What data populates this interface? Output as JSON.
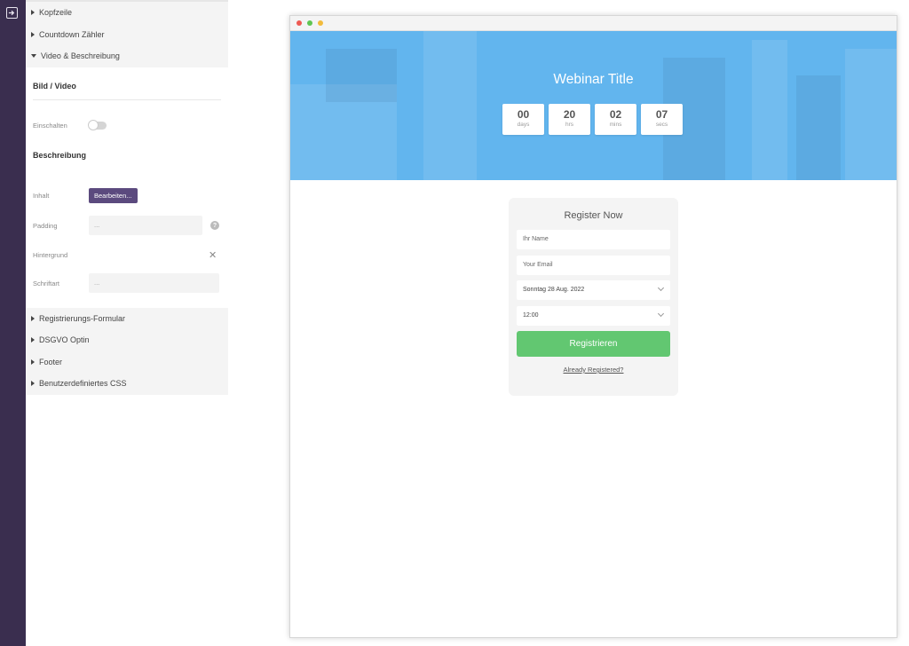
{
  "sidebar": {
    "sections_top": [
      {
        "label": "Kopfzeile"
      },
      {
        "label": "Countdown Zähler"
      },
      {
        "label": "Video & Beschreibung"
      }
    ],
    "bild_video": {
      "title": "Bild / Video",
      "einschalten_label": "Einschalten"
    },
    "beschreibung": {
      "title": "Beschreibung",
      "inhalt_label": "Inhalt",
      "edit_button": "Bearbeiten...",
      "padding_label": "Padding",
      "padding_value": "...",
      "hintergrund_label": "Hintergrund",
      "schriftart_label": "Schriftart",
      "schriftart_value": "..."
    },
    "sections_bottom": [
      {
        "label": "Registrierungs-Formular"
      },
      {
        "label": "DSGVO Optin"
      },
      {
        "label": "Footer"
      },
      {
        "label": "Benutzerdefiniertes CSS"
      }
    ]
  },
  "preview": {
    "hero_title": "Webinar Title",
    "countdown": [
      {
        "value": "00",
        "unit": "days"
      },
      {
        "value": "20",
        "unit": "hrs"
      },
      {
        "value": "02",
        "unit": "mins"
      },
      {
        "value": "07",
        "unit": "secs"
      }
    ],
    "form": {
      "title": "Register Now",
      "name_placeholder": "Ihr Name",
      "email_placeholder": "Your Email",
      "date_value": "Sonntag 28 Aug. 2022",
      "time_value": "12:00",
      "submit_label": "Registrieren",
      "already_link": "Already Registered?"
    }
  },
  "colors": {
    "rail": "#3a2e4f",
    "edit_button": "#5b4a7e",
    "hero": "#62b5ee",
    "submit": "#62c771"
  }
}
